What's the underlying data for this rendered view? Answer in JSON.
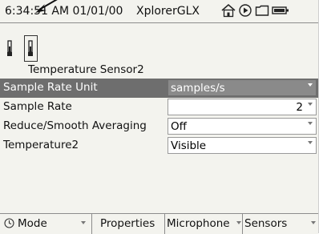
{
  "status_bar": {
    "time": "6:34:51 AM",
    "date": "01/01/00",
    "app_name": "XplorerGLX",
    "icons": [
      "home-icon",
      "play-icon",
      "folder-icon",
      "battery-icon"
    ]
  },
  "sensor": {
    "label": "Temperature Sensor2",
    "icons": [
      "thermometer-icon",
      "thermometer-selected-icon"
    ]
  },
  "properties": [
    {
      "label": "Sample Rate Unit",
      "value": "samples/s",
      "selected": true,
      "align": "left"
    },
    {
      "label": "Sample Rate",
      "value": "2",
      "selected": false,
      "align": "right"
    },
    {
      "label": "Reduce/Smooth Averaging",
      "value": "Off",
      "selected": false,
      "align": "left"
    },
    {
      "label": "Temperature2",
      "value": "Visible",
      "selected": false,
      "align": "left"
    }
  ],
  "softkeys": [
    {
      "label": "Mode",
      "icon": "clock-icon"
    },
    {
      "label": "Properties"
    },
    {
      "label": "Microphone"
    },
    {
      "label": "Sensors"
    }
  ],
  "colors": {
    "screen_bg": "#f3f3ee",
    "selected_row": "#6e6e6e",
    "selected_value": "#8a8a8a"
  }
}
